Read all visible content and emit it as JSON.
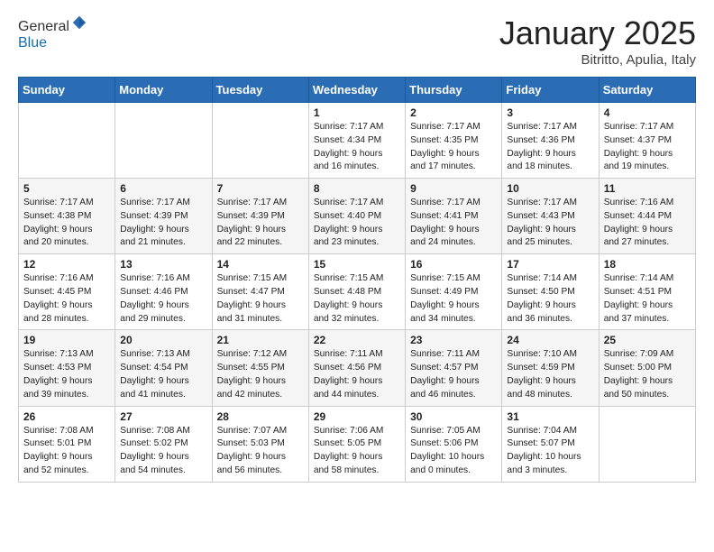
{
  "logo": {
    "general": "General",
    "blue": "Blue"
  },
  "header": {
    "month": "January 2025",
    "location": "Bitritto, Apulia, Italy"
  },
  "weekdays": [
    "Sunday",
    "Monday",
    "Tuesday",
    "Wednesday",
    "Thursday",
    "Friday",
    "Saturday"
  ],
  "weeks": [
    [
      {
        "day": "",
        "info": ""
      },
      {
        "day": "",
        "info": ""
      },
      {
        "day": "",
        "info": ""
      },
      {
        "day": "1",
        "info": "Sunrise: 7:17 AM\nSunset: 4:34 PM\nDaylight: 9 hours\nand 16 minutes."
      },
      {
        "day": "2",
        "info": "Sunrise: 7:17 AM\nSunset: 4:35 PM\nDaylight: 9 hours\nand 17 minutes."
      },
      {
        "day": "3",
        "info": "Sunrise: 7:17 AM\nSunset: 4:36 PM\nDaylight: 9 hours\nand 18 minutes."
      },
      {
        "day": "4",
        "info": "Sunrise: 7:17 AM\nSunset: 4:37 PM\nDaylight: 9 hours\nand 19 minutes."
      }
    ],
    [
      {
        "day": "5",
        "info": "Sunrise: 7:17 AM\nSunset: 4:38 PM\nDaylight: 9 hours\nand 20 minutes."
      },
      {
        "day": "6",
        "info": "Sunrise: 7:17 AM\nSunset: 4:39 PM\nDaylight: 9 hours\nand 21 minutes."
      },
      {
        "day": "7",
        "info": "Sunrise: 7:17 AM\nSunset: 4:39 PM\nDaylight: 9 hours\nand 22 minutes."
      },
      {
        "day": "8",
        "info": "Sunrise: 7:17 AM\nSunset: 4:40 PM\nDaylight: 9 hours\nand 23 minutes."
      },
      {
        "day": "9",
        "info": "Sunrise: 7:17 AM\nSunset: 4:41 PM\nDaylight: 9 hours\nand 24 minutes."
      },
      {
        "day": "10",
        "info": "Sunrise: 7:17 AM\nSunset: 4:43 PM\nDaylight: 9 hours\nand 25 minutes."
      },
      {
        "day": "11",
        "info": "Sunrise: 7:16 AM\nSunset: 4:44 PM\nDaylight: 9 hours\nand 27 minutes."
      }
    ],
    [
      {
        "day": "12",
        "info": "Sunrise: 7:16 AM\nSunset: 4:45 PM\nDaylight: 9 hours\nand 28 minutes."
      },
      {
        "day": "13",
        "info": "Sunrise: 7:16 AM\nSunset: 4:46 PM\nDaylight: 9 hours\nand 29 minutes."
      },
      {
        "day": "14",
        "info": "Sunrise: 7:15 AM\nSunset: 4:47 PM\nDaylight: 9 hours\nand 31 minutes."
      },
      {
        "day": "15",
        "info": "Sunrise: 7:15 AM\nSunset: 4:48 PM\nDaylight: 9 hours\nand 32 minutes."
      },
      {
        "day": "16",
        "info": "Sunrise: 7:15 AM\nSunset: 4:49 PM\nDaylight: 9 hours\nand 34 minutes."
      },
      {
        "day": "17",
        "info": "Sunrise: 7:14 AM\nSunset: 4:50 PM\nDaylight: 9 hours\nand 36 minutes."
      },
      {
        "day": "18",
        "info": "Sunrise: 7:14 AM\nSunset: 4:51 PM\nDaylight: 9 hours\nand 37 minutes."
      }
    ],
    [
      {
        "day": "19",
        "info": "Sunrise: 7:13 AM\nSunset: 4:53 PM\nDaylight: 9 hours\nand 39 minutes."
      },
      {
        "day": "20",
        "info": "Sunrise: 7:13 AM\nSunset: 4:54 PM\nDaylight: 9 hours\nand 41 minutes."
      },
      {
        "day": "21",
        "info": "Sunrise: 7:12 AM\nSunset: 4:55 PM\nDaylight: 9 hours\nand 42 minutes."
      },
      {
        "day": "22",
        "info": "Sunrise: 7:11 AM\nSunset: 4:56 PM\nDaylight: 9 hours\nand 44 minutes."
      },
      {
        "day": "23",
        "info": "Sunrise: 7:11 AM\nSunset: 4:57 PM\nDaylight: 9 hours\nand 46 minutes."
      },
      {
        "day": "24",
        "info": "Sunrise: 7:10 AM\nSunset: 4:59 PM\nDaylight: 9 hours\nand 48 minutes."
      },
      {
        "day": "25",
        "info": "Sunrise: 7:09 AM\nSunset: 5:00 PM\nDaylight: 9 hours\nand 50 minutes."
      }
    ],
    [
      {
        "day": "26",
        "info": "Sunrise: 7:08 AM\nSunset: 5:01 PM\nDaylight: 9 hours\nand 52 minutes."
      },
      {
        "day": "27",
        "info": "Sunrise: 7:08 AM\nSunset: 5:02 PM\nDaylight: 9 hours\nand 54 minutes."
      },
      {
        "day": "28",
        "info": "Sunrise: 7:07 AM\nSunset: 5:03 PM\nDaylight: 9 hours\nand 56 minutes."
      },
      {
        "day": "29",
        "info": "Sunrise: 7:06 AM\nSunset: 5:05 PM\nDaylight: 9 hours\nand 58 minutes."
      },
      {
        "day": "30",
        "info": "Sunrise: 7:05 AM\nSunset: 5:06 PM\nDaylight: 10 hours\nand 0 minutes."
      },
      {
        "day": "31",
        "info": "Sunrise: 7:04 AM\nSunset: 5:07 PM\nDaylight: 10 hours\nand 3 minutes."
      },
      {
        "day": "",
        "info": ""
      }
    ]
  ]
}
